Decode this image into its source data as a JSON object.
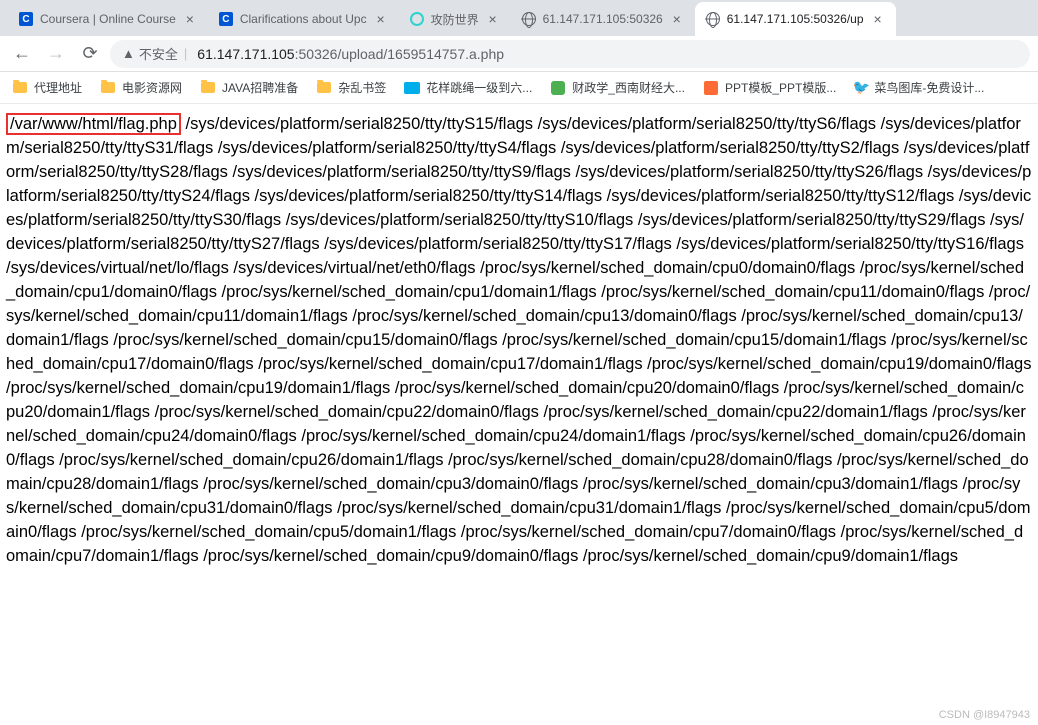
{
  "tabs": [
    {
      "title": "Coursera | Online Course",
      "favicon": "coursera"
    },
    {
      "title": "Clarifications about Upc",
      "favicon": "coursera"
    },
    {
      "title": "攻防世界",
      "favicon": "cyan"
    },
    {
      "title": "61.147.171.105:50326",
      "favicon": "globe"
    },
    {
      "title": "61.147.171.105:50326/up",
      "favicon": "globe",
      "active": true
    }
  ],
  "nav": {
    "insecure_label": "不安全",
    "url_host": "61.147.171.105",
    "url_port": ":50326",
    "url_path": "/upload/1659514757.a.php"
  },
  "bookmarks": [
    {
      "label": "代理地址",
      "icon": "folder"
    },
    {
      "label": "电影资源网",
      "icon": "folder"
    },
    {
      "label": "JAVA招聘准备",
      "icon": "folder"
    },
    {
      "label": "杂乱书签",
      "icon": "folder"
    },
    {
      "label": "花样跳绳一级到六...",
      "icon": "bili"
    },
    {
      "label": "财政学_西南财经大...",
      "icon": "green"
    },
    {
      "label": "PPT模板_PPT模版...",
      "icon": "orange"
    },
    {
      "label": "菜鸟图库-免费设计...",
      "icon": "bird"
    }
  ],
  "content": {
    "highlighted": "/var/www/html/flag.php",
    "body": " /sys/devices/platform/serial8250/tty/ttyS15/flags /sys/devices/platform/serial8250/tty/ttyS6/flags /sys/devices/platform/serial8250/tty/ttyS31/flags /sys/devices/platform/serial8250/tty/ttyS4/flags /sys/devices/platform/serial8250/tty/ttyS2/flags /sys/devices/platform/serial8250/tty/ttyS28/flags /sys/devices/platform/serial8250/tty/ttyS9/flags /sys/devices/platform/serial8250/tty/ttyS26/flags /sys/devices/platform/serial8250/tty/ttyS24/flags /sys/devices/platform/serial8250/tty/ttyS14/flags /sys/devices/platform/serial8250/tty/ttyS12/flags /sys/devices/platform/serial8250/tty/ttyS30/flags /sys/devices/platform/serial8250/tty/ttyS10/flags /sys/devices/platform/serial8250/tty/ttyS29/flags /sys/devices/platform/serial8250/tty/ttyS27/flags /sys/devices/platform/serial8250/tty/ttyS17/flags /sys/devices/platform/serial8250/tty/ttyS16/flags /sys/devices/virtual/net/lo/flags /sys/devices/virtual/net/eth0/flags /proc/sys/kernel/sched_domain/cpu0/domain0/flags /proc/sys/kernel/sched_domain/cpu1/domain0/flags /proc/sys/kernel/sched_domain/cpu1/domain1/flags /proc/sys/kernel/sched_domain/cpu11/domain0/flags /proc/sys/kernel/sched_domain/cpu11/domain1/flags /proc/sys/kernel/sched_domain/cpu13/domain0/flags /proc/sys/kernel/sched_domain/cpu13/domain1/flags /proc/sys/kernel/sched_domain/cpu15/domain0/flags /proc/sys/kernel/sched_domain/cpu15/domain1/flags /proc/sys/kernel/sched_domain/cpu17/domain0/flags /proc/sys/kernel/sched_domain/cpu17/domain1/flags /proc/sys/kernel/sched_domain/cpu19/domain0/flags /proc/sys/kernel/sched_domain/cpu19/domain1/flags /proc/sys/kernel/sched_domain/cpu20/domain0/flags /proc/sys/kernel/sched_domain/cpu20/domain1/flags /proc/sys/kernel/sched_domain/cpu22/domain0/flags /proc/sys/kernel/sched_domain/cpu22/domain1/flags /proc/sys/kernel/sched_domain/cpu24/domain0/flags /proc/sys/kernel/sched_domain/cpu24/domain1/flags /proc/sys/kernel/sched_domain/cpu26/domain0/flags /proc/sys/kernel/sched_domain/cpu26/domain1/flags /proc/sys/kernel/sched_domain/cpu28/domain0/flags /proc/sys/kernel/sched_domain/cpu28/domain1/flags /proc/sys/kernel/sched_domain/cpu3/domain0/flags /proc/sys/kernel/sched_domain/cpu3/domain1/flags /proc/sys/kernel/sched_domain/cpu31/domain0/flags /proc/sys/kernel/sched_domain/cpu31/domain1/flags /proc/sys/kernel/sched_domain/cpu5/domain0/flags /proc/sys/kernel/sched_domain/cpu5/domain1/flags /proc/sys/kernel/sched_domain/cpu7/domain0/flags /proc/sys/kernel/sched_domain/cpu7/domain1/flags /proc/sys/kernel/sched_domain/cpu9/domain0/flags /proc/sys/kernel/sched_domain/cpu9/domain1/flags"
  },
  "watermark": "CSDN @I8947943"
}
